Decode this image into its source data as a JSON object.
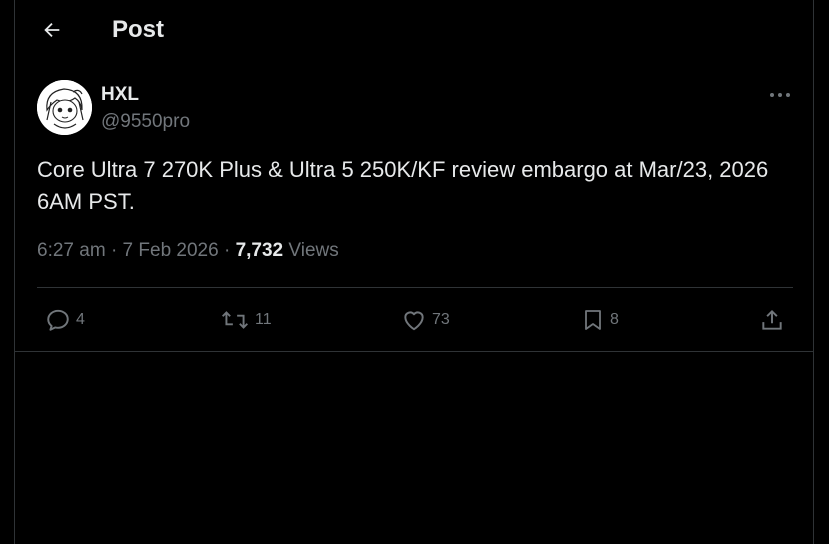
{
  "header": {
    "title": "Post",
    "back_icon": "arrow-left-icon"
  },
  "author": {
    "display_name": "HXL",
    "handle": "@9550pro",
    "avatar_icon": "anime-avatar"
  },
  "tweet": {
    "text": "Core Ultra 7 270K Plus & Ultra 5 250K/KF review embargo at Mar/23, 2026 6AM PST.",
    "time": "6:27 am",
    "date": "7 Feb 2026",
    "separator": "·",
    "views_count": "7,732",
    "views_label": "Views"
  },
  "actions": {
    "replies": "4",
    "reposts": "11",
    "likes": "73",
    "bookmarks": "8"
  },
  "colors": {
    "background": "#000000",
    "text_primary": "#e7e9ea",
    "text_secondary": "#71767b",
    "border": "#2f3336"
  }
}
